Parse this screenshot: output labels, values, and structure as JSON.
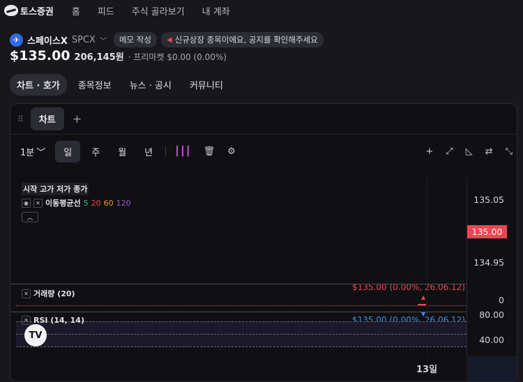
{
  "brand": {
    "name": "토스증권"
  },
  "nav": {
    "items": [
      "홈",
      "피드",
      "주식 골라보기",
      "내 계좌"
    ]
  },
  "stock": {
    "name": "스페이스X",
    "code": "SPCX",
    "memo_label": "메모 작성",
    "notice": "신규상장 종목이에요, 공지를 확인해주세요",
    "price": "$135.00",
    "price_krw": "206,145원",
    "premarket": "· 프리마켓 $0.00 (0.00%)"
  },
  "tabs": [
    "차트 · 호가",
    "종목정보",
    "뉴스 · 공시",
    "커뮤니티"
  ],
  "chart_panel": {
    "tab_label": "차트",
    "timeframe": "1분",
    "periods": [
      "일",
      "주",
      "월",
      "년"
    ],
    "legend_title": "시작 고가 저가 종가",
    "ma_name": "이동평균선",
    "ma_periods": [
      "5",
      "20",
      "60",
      "120"
    ],
    "high_label": "$135.00 (0.00%, 26.06.12)",
    "low_label": "$135.00 (0.00%, 26.06.12)",
    "volume_label": "거래량 (20)",
    "rsi_label": "RSI (14, 14)",
    "date_label": "13일",
    "tv_logo": "TV"
  },
  "chart_data": {
    "type": "line",
    "x": [
      "26.06.12"
    ],
    "series": [
      {
        "values": [
          135.0
        ]
      }
    ],
    "current_price": "135.00",
    "price_axis_ticks": [
      "135.05",
      "134.95"
    ],
    "volume_axis_ticks": [
      "0"
    ],
    "rsi_axis_ticks": [
      "80.00",
      "40.00"
    ],
    "colors": {
      "up": "#f04452",
      "down": "#3d8ef0",
      "ma5": "#46b97a",
      "ma20": "#f04452",
      "ma60": "#f0a030",
      "ma120": "#9a5ad6"
    }
  }
}
